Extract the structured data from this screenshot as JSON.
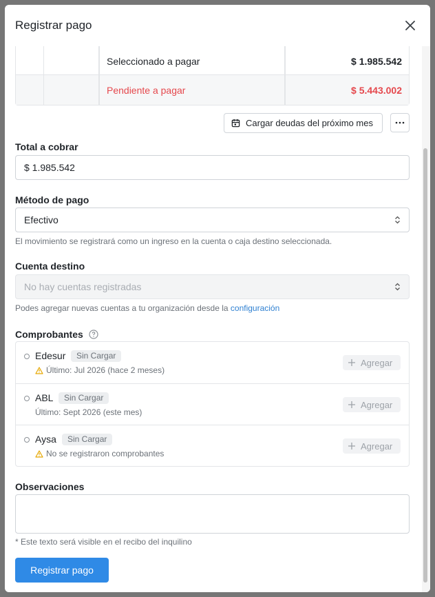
{
  "dialog": {
    "title": "Registrar pago"
  },
  "summary": {
    "rows": [
      {
        "label": "Seleccionado a pagar",
        "value": "$ 1.985.542"
      },
      {
        "label": "Pendiente a pagar",
        "value": "$ 5.443.002"
      }
    ]
  },
  "actions": {
    "load_next_month_label": "Cargar deudas del próximo mes"
  },
  "total": {
    "label": "Total a cobrar",
    "value": "$ 1.985.542"
  },
  "payment_method": {
    "label": "Método de pago",
    "value": "Efectivo",
    "help": "El movimiento se registrará como un ingreso en la cuenta o caja destino seleccionada."
  },
  "destination": {
    "label": "Cuenta destino",
    "placeholder": "No hay cuentas registradas",
    "help_prefix": "Podes agregar nuevas cuentas a tu organización desde la ",
    "help_link": "configuración"
  },
  "comprobantes": {
    "label": "Comprobantes",
    "add_label": "Agregar",
    "items": [
      {
        "name": "Edesur",
        "badge": "Sin Cargar",
        "sub": "Último: Jul 2026 (hace 2 meses)",
        "warning": true
      },
      {
        "name": "ABL",
        "badge": "Sin Cargar",
        "sub": "Último: Sept 2026 (este mes)",
        "warning": false
      },
      {
        "name": "Aysa",
        "badge": "Sin Cargar",
        "sub": "No se registraron comprobantes",
        "warning": true
      }
    ]
  },
  "observations": {
    "label": "Observaciones",
    "help": "* Este texto será visible en el recibo del inquilino"
  },
  "submit_label": "Registrar pago",
  "colors": {
    "primary": "#2f8ae6",
    "danger": "#e5484d",
    "warning": "#e6a700",
    "link": "#2f80d1"
  }
}
